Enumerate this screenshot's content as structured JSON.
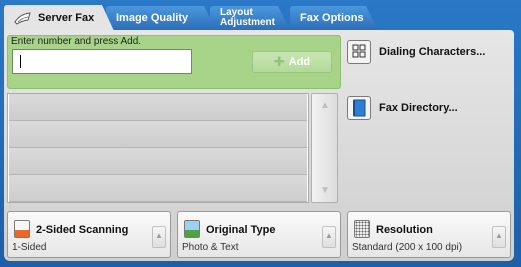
{
  "tabs": [
    {
      "label": "Server Fax",
      "active": true,
      "icon": "server-fax-icon"
    },
    {
      "label": "Image Quality",
      "active": false
    },
    {
      "label_line1": "Layout",
      "label_line2": "Adjustment",
      "active": false
    },
    {
      "label": "Fax Options",
      "active": false
    }
  ],
  "entry": {
    "label": "Enter number and press Add.",
    "value": "",
    "add_label": "Add",
    "add_icon": "plus-icon"
  },
  "side_buttons": [
    {
      "label": "Dialing Characters...",
      "icon": "keypad-icon"
    },
    {
      "label": "Fax Directory...",
      "icon": "book-icon"
    }
  ],
  "recipient_list": {
    "rows": [
      "",
      "",
      "",
      ""
    ],
    "scroll_up": "▲",
    "scroll_down": "▼"
  },
  "bottom_buttons": [
    {
      "title": "2-Sided Scanning",
      "value": "1-Sided",
      "icon": "two-sided-icon"
    },
    {
      "title": "Original Type",
      "value": "Photo & Text",
      "icon": "original-type-icon"
    },
    {
      "title": "Resolution",
      "value": "Standard (200 x 100 dpi)",
      "icon": "resolution-icon"
    }
  ],
  "colors": {
    "frame_blue": "#2a78c6",
    "entry_green": "#a8d48a",
    "panel_gray": "#e4e4e4"
  }
}
